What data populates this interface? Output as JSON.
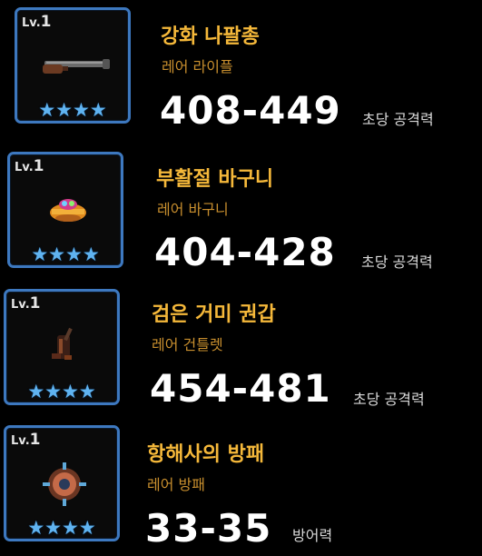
{
  "items": [
    {
      "level_prefix": "Lv.",
      "level": "1",
      "stars": "★★★★",
      "name": "강화 나팔총",
      "type": "레어 라이플",
      "stat": "408-449",
      "stat_label": "초당 공격력",
      "icon": "blunderbuss-icon"
    },
    {
      "level_prefix": "Lv.",
      "level": "1",
      "stars": "★★★★",
      "name": "부활절 바구니",
      "type": "레어 바구니",
      "stat": "404-428",
      "stat_label": "초당 공격력",
      "icon": "easter-basket-icon"
    },
    {
      "level_prefix": "Lv.",
      "level": "1",
      "stars": "★★★★",
      "name": "검은 거미 권갑",
      "type": "레어 건틀렛",
      "stat": "454-481",
      "stat_label": "초당 공격력",
      "icon": "spider-gauntlet-icon"
    },
    {
      "level_prefix": "Lv.",
      "level": "1",
      "stars": "★★★★",
      "name": "항해사의 방패",
      "type": "레어 방패",
      "stat": "33-35",
      "stat_label": "방어력",
      "icon": "navigator-shield-icon"
    }
  ],
  "colors": {
    "card_border": "#3d78bf",
    "name": "#f5b83a",
    "type": "#c98f2e",
    "stars": "#5fb3f0"
  }
}
